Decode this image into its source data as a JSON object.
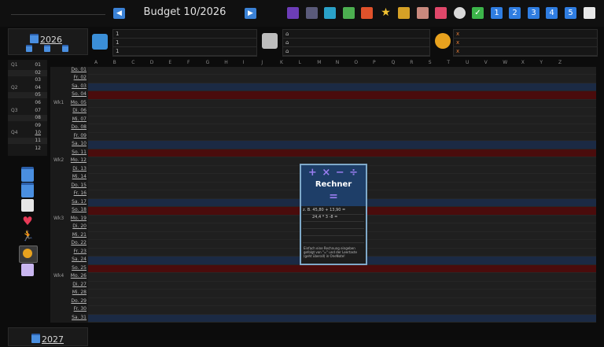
{
  "header": {
    "title": "Budget 10/2026",
    "prev_label": "◀",
    "next_label": "▶",
    "toolbar_numbers": [
      "1",
      "2",
      "3",
      "4",
      "5"
    ]
  },
  "year_current": "2026",
  "year_next": "2027",
  "summary": {
    "left_rows": [
      "1",
      "1",
      "1"
    ],
    "mid_rows": [
      "⌂",
      "⌂",
      "⌂"
    ],
    "right_rows": [
      "x",
      "x",
      "x"
    ]
  },
  "columns": [
    "A",
    "B",
    "C",
    "D",
    "E",
    "F",
    "G",
    "H",
    "I",
    "J",
    "K",
    "L",
    "M",
    "N",
    "O",
    "P",
    "Q",
    "R",
    "S",
    "T",
    "U",
    "V",
    "W",
    "X",
    "Y",
    "Z"
  ],
  "months": [
    {
      "q": "Q1",
      "m": "01"
    },
    {
      "q": "",
      "m": "02"
    },
    {
      "q": "",
      "m": "03"
    },
    {
      "q": "Q2",
      "m": "04"
    },
    {
      "q": "",
      "m": "05"
    },
    {
      "q": "",
      "m": "06"
    },
    {
      "q": "Q3",
      "m": "07"
    },
    {
      "q": "",
      "m": "08"
    },
    {
      "q": "",
      "m": "09"
    },
    {
      "q": "Q4",
      "m": "10"
    },
    {
      "q": "",
      "m": "11"
    },
    {
      "q": "",
      "m": "12"
    }
  ],
  "days": [
    {
      "wk": "",
      "d": "Do. 01",
      "t": ""
    },
    {
      "wk": "",
      "d": "Fr. 02",
      "t": ""
    },
    {
      "wk": "",
      "d": "Sa. 03",
      "t": "sat"
    },
    {
      "wk": "",
      "d": "So. 04",
      "t": "sun"
    },
    {
      "wk": "Wk1",
      "d": "Mo. 05",
      "t": ""
    },
    {
      "wk": "",
      "d": "Di. 06",
      "t": ""
    },
    {
      "wk": "",
      "d": "Mi. 07",
      "t": ""
    },
    {
      "wk": "",
      "d": "Do. 08",
      "t": ""
    },
    {
      "wk": "",
      "d": "Fr. 09",
      "t": ""
    },
    {
      "wk": "",
      "d": "Sa. 10",
      "t": "sat"
    },
    {
      "wk": "",
      "d": "So. 11",
      "t": "sun"
    },
    {
      "wk": "Wk2",
      "d": "Mo. 12",
      "t": ""
    },
    {
      "wk": "",
      "d": "Di. 13",
      "t": ""
    },
    {
      "wk": "",
      "d": "Mi. 14",
      "t": ""
    },
    {
      "wk": "",
      "d": "Do. 15",
      "t": ""
    },
    {
      "wk": "",
      "d": "Fr. 16",
      "t": ""
    },
    {
      "wk": "",
      "d": "Sa. 17",
      "t": "sat"
    },
    {
      "wk": "",
      "d": "So. 18",
      "t": "sun"
    },
    {
      "wk": "Wk3",
      "d": "Mo. 19",
      "t": ""
    },
    {
      "wk": "",
      "d": "Di. 20",
      "t": ""
    },
    {
      "wk": "",
      "d": "Mi. 21",
      "t": ""
    },
    {
      "wk": "",
      "d": "Do. 22",
      "t": ""
    },
    {
      "wk": "",
      "d": "Fr. 23",
      "t": ""
    },
    {
      "wk": "",
      "d": "Sa. 24",
      "t": "sat"
    },
    {
      "wk": "",
      "d": "So. 25",
      "t": "sun"
    },
    {
      "wk": "Wk4",
      "d": "Mo. 26",
      "t": ""
    },
    {
      "wk": "",
      "d": "Di. 27",
      "t": ""
    },
    {
      "wk": "",
      "d": "Mi. 28",
      "t": ""
    },
    {
      "wk": "",
      "d": "Do. 29",
      "t": ""
    },
    {
      "wk": "",
      "d": "Fr. 30",
      "t": ""
    },
    {
      "wk": "",
      "d": "Sa. 31",
      "t": "sat"
    }
  ],
  "calculator": {
    "ops": "+ × − ÷",
    "title": "Rechner",
    "eq": "=",
    "lines": [
      "z. B. 45,80 + 13,90 =",
      "24,4 * 3 -8 =",
      "",
      "",
      "",
      ""
    ],
    "help": "Einfach eine Rechnung eingeben gefolgt von \"=\" und der Leertaste (geht überall) in OneNote!"
  }
}
